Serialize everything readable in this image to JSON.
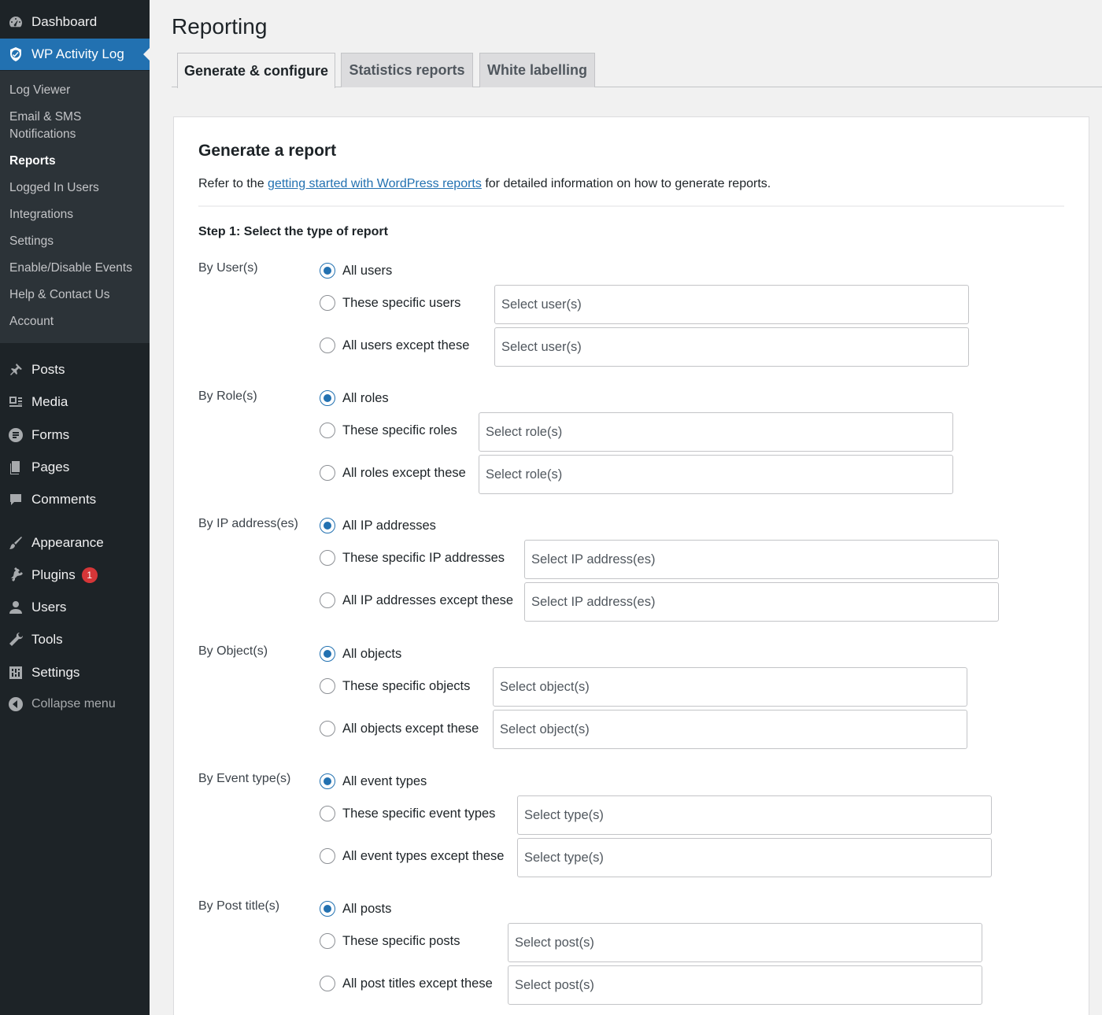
{
  "sidebar": {
    "top_items": [
      {
        "label": "Dashboard",
        "icon": "dashboard-icon"
      },
      {
        "label": "WP Activity Log",
        "icon": "shield-icon"
      }
    ],
    "submenu": [
      {
        "label": "Log Viewer"
      },
      {
        "label": "Email & SMS\nNotifications"
      },
      {
        "label": "Reports"
      },
      {
        "label": "Logged In Users"
      },
      {
        "label": "Integrations"
      },
      {
        "label": "Settings"
      },
      {
        "label": "Enable/Disable Events"
      },
      {
        "label": "Help & Contact Us"
      },
      {
        "label": "Account"
      }
    ],
    "menu_items": [
      {
        "label": "Posts",
        "icon": "pin-icon"
      },
      {
        "label": "Media",
        "icon": "media-icon"
      },
      {
        "label": "Forms",
        "icon": "forms-icon"
      },
      {
        "label": "Pages",
        "icon": "pages-icon"
      },
      {
        "label": "Comments",
        "icon": "comment-icon"
      },
      {
        "label": "Appearance",
        "icon": "brush-icon"
      },
      {
        "label": "Plugins",
        "icon": "plug-icon",
        "badge": "1"
      },
      {
        "label": "Users",
        "icon": "user-icon"
      },
      {
        "label": "Tools",
        "icon": "wrench-icon"
      },
      {
        "label": "Settings",
        "icon": "settings-icon"
      }
    ],
    "collapse_label": "Collapse menu"
  },
  "page": {
    "title": "Reporting",
    "tabs": [
      {
        "label": "Generate & configure"
      },
      {
        "label": "Statistics reports"
      },
      {
        "label": "White labelling"
      }
    ]
  },
  "panel": {
    "title": "Generate a report",
    "intro_before": "Refer to the ",
    "intro_link": "getting started with WordPress reports",
    "intro_after": " for detailed information on how to generate reports.",
    "step_title": "Step 1: Select the type of report",
    "groups": [
      {
        "label": "By User(s)",
        "options": [
          "All users",
          "These specific users",
          "All users except these"
        ],
        "placeholder": "Select user(s)"
      },
      {
        "label": "By Role(s)",
        "options": [
          "All roles",
          "These specific roles",
          "All roles except these"
        ],
        "placeholder": "Select role(s)"
      },
      {
        "label": "By IP address(es)",
        "options": [
          "All IP addresses",
          "These specific IP addresses",
          "All IP addresses except these"
        ],
        "placeholder": "Select IP address(es)"
      },
      {
        "label": "By Object(s)",
        "options": [
          "All objects",
          "These specific objects",
          "All objects except these"
        ],
        "placeholder": "Select object(s)"
      },
      {
        "label": "By Event type(s)",
        "options": [
          "All event types",
          "These specific event types",
          "All event types except these"
        ],
        "placeholder": "Select type(s)"
      },
      {
        "label": "By Post title(s)",
        "options": [
          "All posts",
          "These specific posts",
          "All post titles except these"
        ],
        "placeholder": "Select post(s)"
      }
    ]
  },
  "colors": {
    "accent": "#2271b1",
    "sidebar_bg": "#1d2327",
    "submenu_bg": "#2c3338",
    "badge": "#d63638"
  }
}
